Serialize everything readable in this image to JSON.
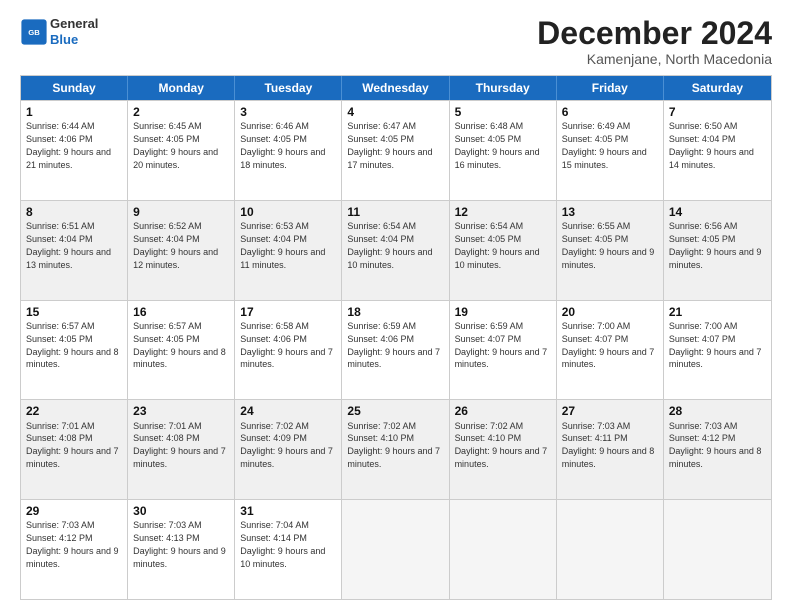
{
  "header": {
    "logo_general": "General",
    "logo_blue": "Blue",
    "month_title": "December 2024",
    "location": "Kamenjane, North Macedonia"
  },
  "days_of_week": [
    "Sunday",
    "Monday",
    "Tuesday",
    "Wednesday",
    "Thursday",
    "Friday",
    "Saturday"
  ],
  "weeks": [
    [
      {
        "day": 1,
        "sunrise": "6:44 AM",
        "sunset": "4:06 PM",
        "daylight": "9 hours and 21 minutes."
      },
      {
        "day": 2,
        "sunrise": "6:45 AM",
        "sunset": "4:05 PM",
        "daylight": "9 hours and 20 minutes."
      },
      {
        "day": 3,
        "sunrise": "6:46 AM",
        "sunset": "4:05 PM",
        "daylight": "9 hours and 18 minutes."
      },
      {
        "day": 4,
        "sunrise": "6:47 AM",
        "sunset": "4:05 PM",
        "daylight": "9 hours and 17 minutes."
      },
      {
        "day": 5,
        "sunrise": "6:48 AM",
        "sunset": "4:05 PM",
        "daylight": "9 hours and 16 minutes."
      },
      {
        "day": 6,
        "sunrise": "6:49 AM",
        "sunset": "4:05 PM",
        "daylight": "9 hours and 15 minutes."
      },
      {
        "day": 7,
        "sunrise": "6:50 AM",
        "sunset": "4:04 PM",
        "daylight": "9 hours and 14 minutes."
      }
    ],
    [
      {
        "day": 8,
        "sunrise": "6:51 AM",
        "sunset": "4:04 PM",
        "daylight": "9 hours and 13 minutes."
      },
      {
        "day": 9,
        "sunrise": "6:52 AM",
        "sunset": "4:04 PM",
        "daylight": "9 hours and 12 minutes."
      },
      {
        "day": 10,
        "sunrise": "6:53 AM",
        "sunset": "4:04 PM",
        "daylight": "9 hours and 11 minutes."
      },
      {
        "day": 11,
        "sunrise": "6:54 AM",
        "sunset": "4:04 PM",
        "daylight": "9 hours and 10 minutes."
      },
      {
        "day": 12,
        "sunrise": "6:54 AM",
        "sunset": "4:05 PM",
        "daylight": "9 hours and 10 minutes."
      },
      {
        "day": 13,
        "sunrise": "6:55 AM",
        "sunset": "4:05 PM",
        "daylight": "9 hours and 9 minutes."
      },
      {
        "day": 14,
        "sunrise": "6:56 AM",
        "sunset": "4:05 PM",
        "daylight": "9 hours and 9 minutes."
      }
    ],
    [
      {
        "day": 15,
        "sunrise": "6:57 AM",
        "sunset": "4:05 PM",
        "daylight": "9 hours and 8 minutes."
      },
      {
        "day": 16,
        "sunrise": "6:57 AM",
        "sunset": "4:05 PM",
        "daylight": "9 hours and 8 minutes."
      },
      {
        "day": 17,
        "sunrise": "6:58 AM",
        "sunset": "4:06 PM",
        "daylight": "9 hours and 7 minutes."
      },
      {
        "day": 18,
        "sunrise": "6:59 AM",
        "sunset": "4:06 PM",
        "daylight": "9 hours and 7 minutes."
      },
      {
        "day": 19,
        "sunrise": "6:59 AM",
        "sunset": "4:07 PM",
        "daylight": "9 hours and 7 minutes."
      },
      {
        "day": 20,
        "sunrise": "7:00 AM",
        "sunset": "4:07 PM",
        "daylight": "9 hours and 7 minutes."
      },
      {
        "day": 21,
        "sunrise": "7:00 AM",
        "sunset": "4:07 PM",
        "daylight": "9 hours and 7 minutes."
      }
    ],
    [
      {
        "day": 22,
        "sunrise": "7:01 AM",
        "sunset": "4:08 PM",
        "daylight": "9 hours and 7 minutes."
      },
      {
        "day": 23,
        "sunrise": "7:01 AM",
        "sunset": "4:08 PM",
        "daylight": "9 hours and 7 minutes."
      },
      {
        "day": 24,
        "sunrise": "7:02 AM",
        "sunset": "4:09 PM",
        "daylight": "9 hours and 7 minutes."
      },
      {
        "day": 25,
        "sunrise": "7:02 AM",
        "sunset": "4:10 PM",
        "daylight": "9 hours and 7 minutes."
      },
      {
        "day": 26,
        "sunrise": "7:02 AM",
        "sunset": "4:10 PM",
        "daylight": "9 hours and 7 minutes."
      },
      {
        "day": 27,
        "sunrise": "7:03 AM",
        "sunset": "4:11 PM",
        "daylight": "9 hours and 8 minutes."
      },
      {
        "day": 28,
        "sunrise": "7:03 AM",
        "sunset": "4:12 PM",
        "daylight": "9 hours and 8 minutes."
      }
    ],
    [
      {
        "day": 29,
        "sunrise": "7:03 AM",
        "sunset": "4:12 PM",
        "daylight": "9 hours and 9 minutes."
      },
      {
        "day": 30,
        "sunrise": "7:03 AM",
        "sunset": "4:13 PM",
        "daylight": "9 hours and 9 minutes."
      },
      {
        "day": 31,
        "sunrise": "7:04 AM",
        "sunset": "4:14 PM",
        "daylight": "9 hours and 10 minutes."
      },
      null,
      null,
      null,
      null
    ]
  ]
}
